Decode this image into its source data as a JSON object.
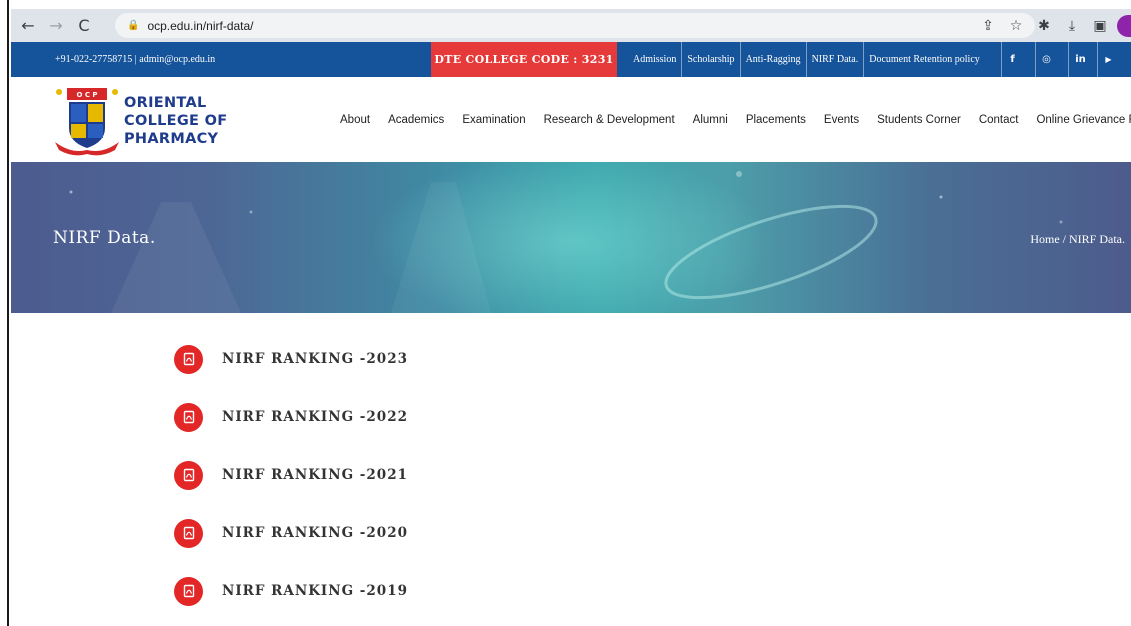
{
  "browser": {
    "url": "ocp.edu.in/nirf-data/",
    "back_icon": "arrow-left-icon",
    "forward_icon": "arrow-right-icon",
    "reload_icon": "reload-icon"
  },
  "topbar": {
    "contact": "+91-022-27758715 | admin@ocp.edu.in",
    "dte_code": "DTE COLLEGE CODE : 3231",
    "links": [
      {
        "label": "Admission"
      },
      {
        "label": "Scholarship"
      },
      {
        "label": "Anti-Ragging"
      },
      {
        "label": "NIRF Data."
      },
      {
        "label": "Document Retention policy"
      }
    ],
    "social": {
      "facebook": "f",
      "instagram": "◎",
      "linkedin": "in",
      "youtube": "▶"
    },
    "colors": {
      "bar": "#15539a",
      "badge": "#e63a3a"
    }
  },
  "header": {
    "logo_line1": "ORIENTAL",
    "logo_line2": "COLLEGE OF",
    "logo_line3": "PHARMACY",
    "logo_badge": "O C P",
    "nav": [
      {
        "label": "About"
      },
      {
        "label": "Academics"
      },
      {
        "label": "Examination"
      },
      {
        "label": "Research & Development"
      },
      {
        "label": "Alumni"
      },
      {
        "label": "Placements"
      },
      {
        "label": "Events"
      },
      {
        "label": "Students Corner"
      },
      {
        "label": "Contact"
      },
      {
        "label": "Online Grievance Redressal"
      }
    ]
  },
  "banner": {
    "title": "NIRF Data.",
    "breadcrumb": "Home / NIRF Data."
  },
  "documents": [
    {
      "label": "NIRF RANKING -2023",
      "icon": "pdf-icon"
    },
    {
      "label": "NIRF RANKING -2022",
      "icon": "pdf-icon"
    },
    {
      "label": "NIRF RANKING -2021",
      "icon": "pdf-icon"
    },
    {
      "label": "NIRF RANKING -2020",
      "icon": "pdf-icon"
    },
    {
      "label": "NIRF RANKING -2019",
      "icon": "pdf-icon"
    }
  ]
}
